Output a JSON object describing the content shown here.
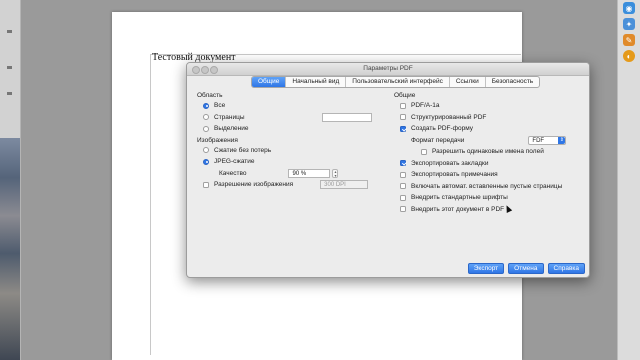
{
  "document": {
    "text": "Тестовый документ"
  },
  "dialog": {
    "title": "Параметры PDF",
    "tabs": [
      {
        "label": "Общие",
        "active": true
      },
      {
        "label": "Начальный вид",
        "active": false
      },
      {
        "label": "Пользовательский интерфейс",
        "active": false
      },
      {
        "label": "Ссылки",
        "active": false
      },
      {
        "label": "Безопасность",
        "active": false
      }
    ],
    "left": {
      "area_heading": "Область",
      "all_label": "Все",
      "pages_label": "Страницы",
      "pages_value": "",
      "selection_label": "Выделение",
      "images_heading": "Изображения",
      "lossless_label": "Сжатие без потерь",
      "jpeg_label": "JPEG-сжатие",
      "quality_label": "Качество",
      "quality_value": "90 %",
      "resolution_label": "Разрешение изображения",
      "resolution_value": "300 DPI"
    },
    "right": {
      "general_heading": "Общие",
      "pdfa_label": "PDF/A-1a",
      "tagged_label": "Структурированный PDF",
      "form_label": "Создать PDF-форму",
      "format_label": "Формат передачи",
      "format_value": "FDF",
      "duplicate_names_label": "Разрешить одинаковые имена полей",
      "bookmarks_label": "Экспортировать закладки",
      "notes_label": "Экспортировать примечания",
      "empty_pages_label": "Включать автомат. вставленные пустые страницы",
      "embed_fonts_label": "Внедрить стандартные шрифты",
      "embed_doc_label": "Внедрить этот документ в PDF"
    },
    "buttons": {
      "export": "Экспорт",
      "cancel": "Отмена",
      "help": "Справка"
    }
  },
  "colors": {
    "accent": "#2f76e6",
    "dialog_bg": "#ececec",
    "desktop": "#9a9a9a"
  }
}
